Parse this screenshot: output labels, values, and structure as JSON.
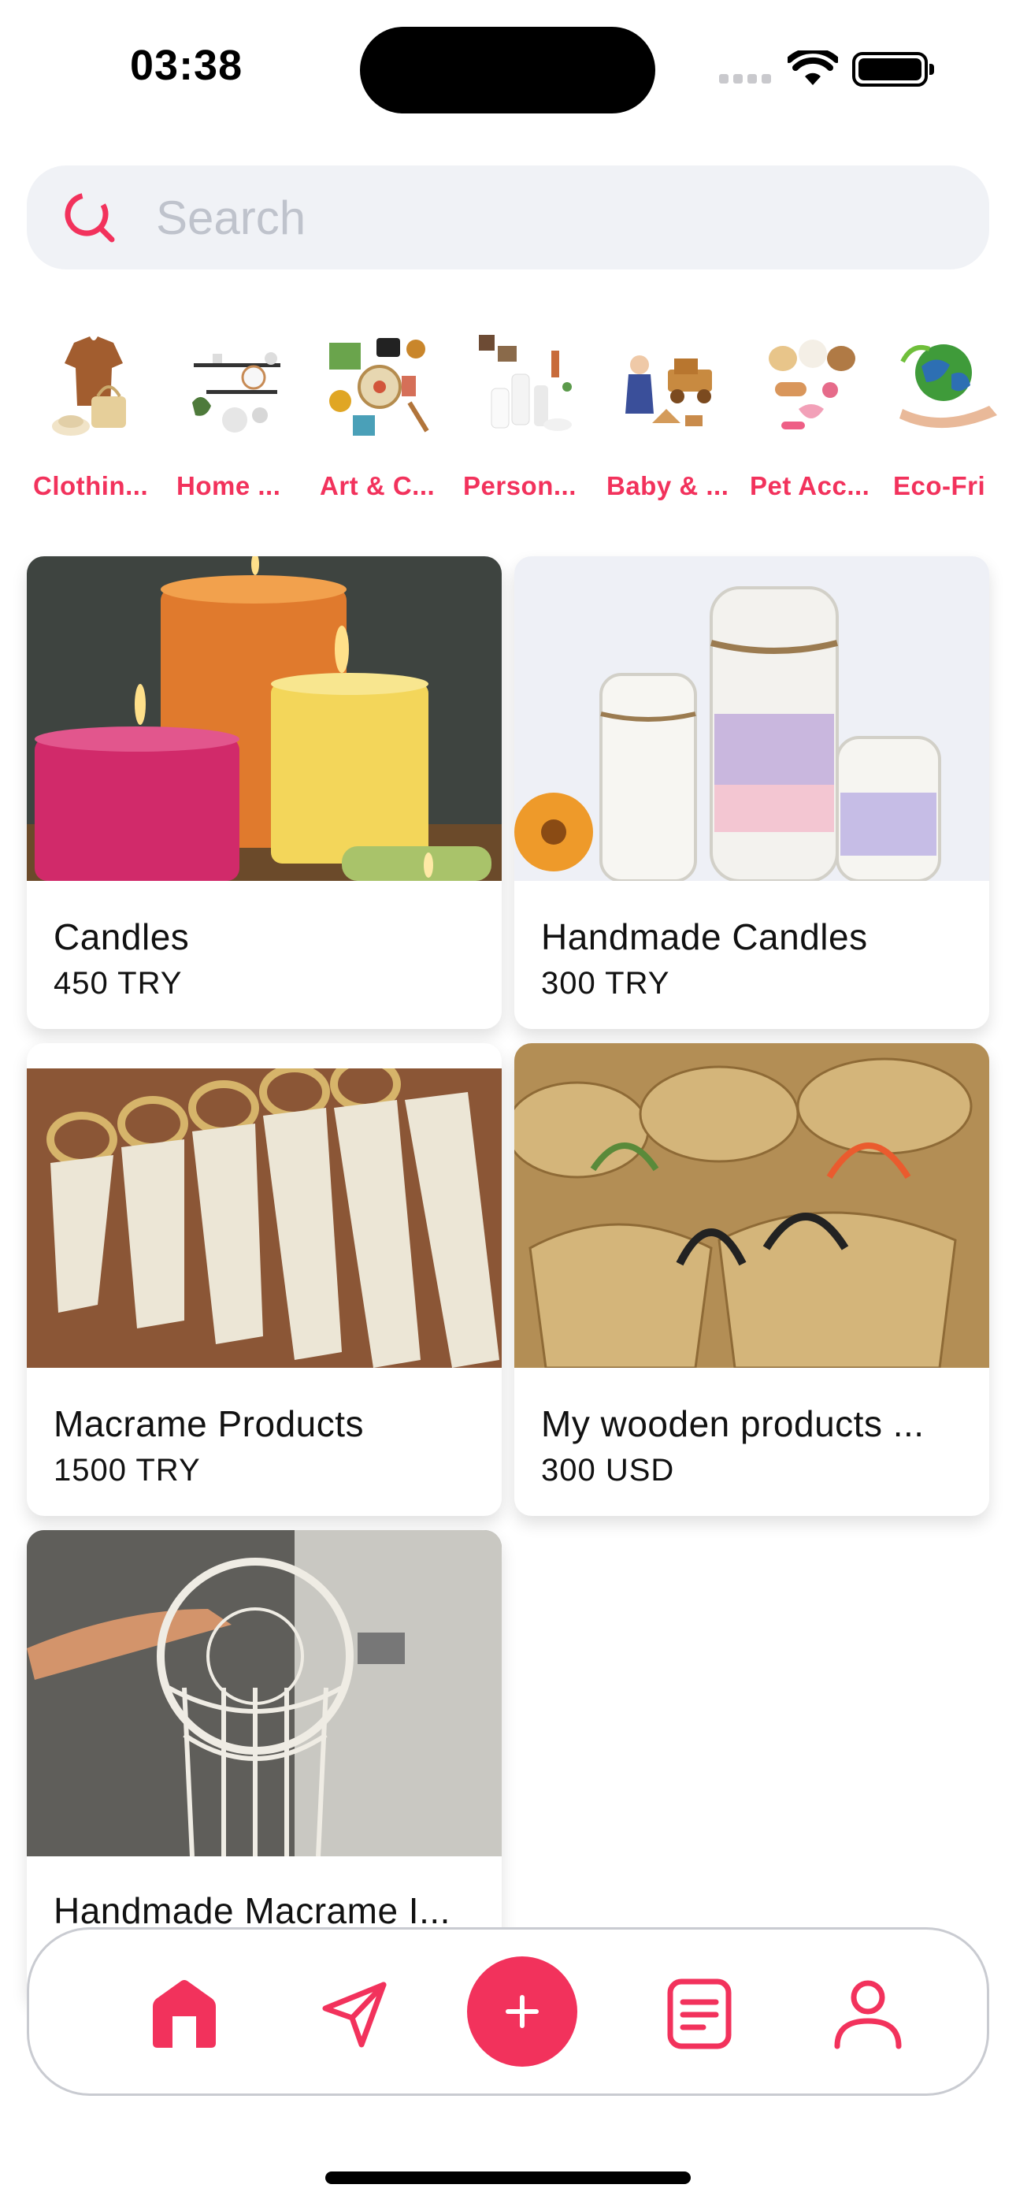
{
  "status_bar": {
    "time": "03:38"
  },
  "search": {
    "placeholder": "Search"
  },
  "categories": [
    {
      "label": "Clothin..."
    },
    {
      "label": "Home ..."
    },
    {
      "label": "Art & C..."
    },
    {
      "label": "Person..."
    },
    {
      "label": "Baby & ..."
    },
    {
      "label": "Pet Acc..."
    },
    {
      "label": "Eco-Fri"
    }
  ],
  "products": [
    {
      "name": "Candles",
      "price": "450 TRY"
    },
    {
      "name": "Handmade Candles",
      "price": "300 TRY"
    },
    {
      "name": "Macrame Products",
      "price": "1500 TRY"
    },
    {
      "name": "My wooden products ...",
      "price": "300 USD"
    },
    {
      "name": "Handmade Macrame I...",
      "price": ""
    }
  ],
  "colors": {
    "accent": "#f2325c",
    "search_bg": "#f0f2f6",
    "nav_border": "#c9cbd1"
  },
  "bottom_nav": {
    "icons": [
      "home-icon",
      "send-icon",
      "plus-icon",
      "document-icon",
      "profile-icon"
    ],
    "active": "home-icon"
  }
}
